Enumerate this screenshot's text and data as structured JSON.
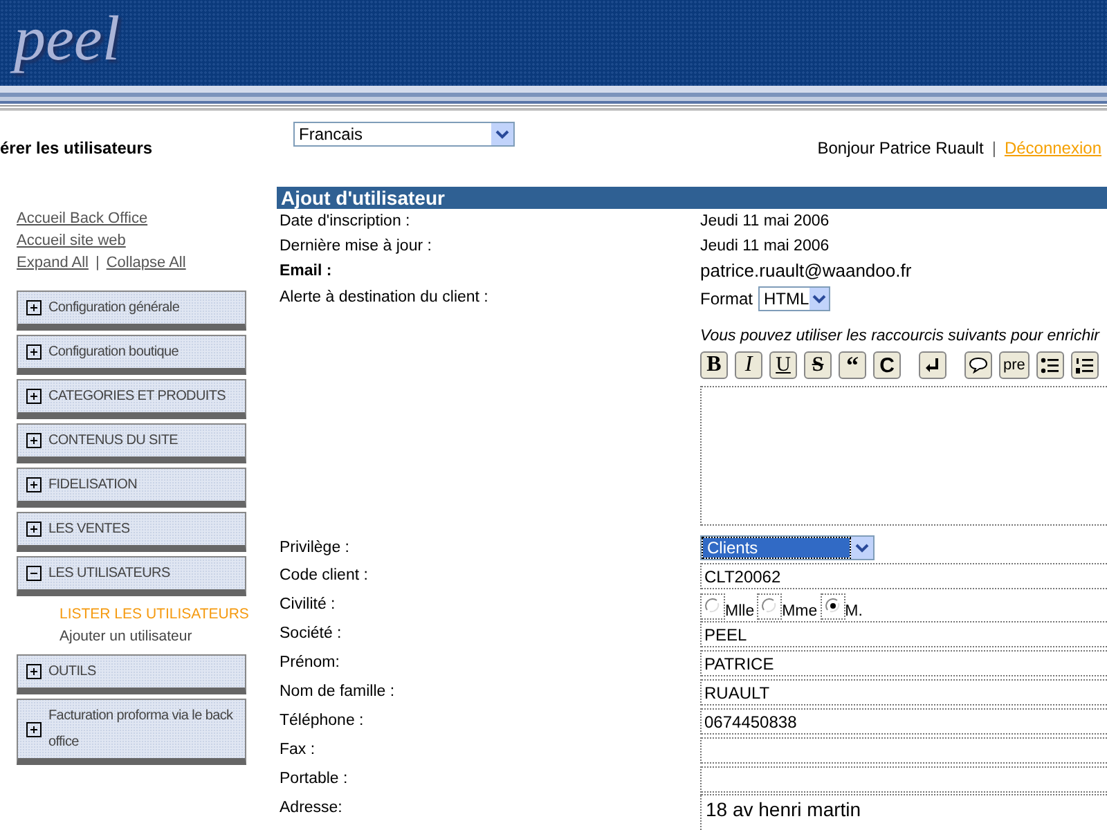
{
  "header": {
    "logo": "peel"
  },
  "top_bar": {
    "page_title": "érer les utilisateurs",
    "language": "Francais",
    "greeting": "Bonjour Patrice Ruault",
    "separator": "|",
    "logout": "Déconnexion"
  },
  "sidebar": {
    "links": [
      {
        "label": "Accueil Back Office"
      },
      {
        "label": "Accueil site web"
      }
    ],
    "expand_all": "Expand All",
    "link_separator": "|",
    "collapse_all": "Collapse All",
    "items": [
      {
        "label": "Configuration générale",
        "expanded": false
      },
      {
        "label": "Configuration boutique",
        "expanded": false
      },
      {
        "label": "CATEGORIES ET PRODUITS",
        "expanded": false
      },
      {
        "label": "CONTENUS DU SITE",
        "expanded": false
      },
      {
        "label": "FIDELISATION",
        "expanded": false
      },
      {
        "label": "LES VENTES",
        "expanded": false
      },
      {
        "label": "LES UTILISATEURS",
        "expanded": true,
        "children": [
          {
            "label": "LISTER LES UTILISATEURS",
            "selected": true
          },
          {
            "label": "Ajouter un utilisateur",
            "selected": false
          }
        ]
      },
      {
        "label": "OUTILS",
        "expanded": false
      },
      {
        "label": "Facturation proforma via le back office",
        "expanded": false
      }
    ]
  },
  "form": {
    "title": "Ajout d'utilisateur",
    "fields": [
      {
        "kind": "static",
        "label": "Date d'inscription :",
        "value": "Jeudi 11 mai 2006",
        "bold": false
      },
      {
        "kind": "static",
        "label": "Dernière mise à jour :",
        "value": "Jeudi 11 mai 2006",
        "bold": false
      },
      {
        "kind": "static",
        "label": "Email :",
        "value": "patrice.ruault@waandoo.fr",
        "bold": true
      },
      {
        "kind": "editor",
        "label": "Alerte à destination du client :",
        "format_label": "Format",
        "format_value": "HTML",
        "hint": "Vous pouvez utiliser les raccourcis suivants pour enrichir",
        "tools": [
          {
            "kind": "text",
            "text": "B"
          },
          {
            "kind": "text",
            "text": "I"
          },
          {
            "kind": "text",
            "text": "U"
          },
          {
            "kind": "text",
            "text": "S"
          },
          {
            "kind": "text",
            "text": "“"
          },
          {
            "kind": "text",
            "text": "C"
          },
          {
            "kind": "return"
          },
          {
            "kind": "bubble"
          },
          {
            "kind": "text",
            "text": "pre"
          },
          {
            "kind": "bullets"
          },
          {
            "kind": "numbers"
          }
        ]
      },
      {
        "kind": "select",
        "label": "Privilège :",
        "value": "Clients"
      },
      {
        "kind": "input",
        "label": "Code client :",
        "value": "CLT20062"
      },
      {
        "kind": "radio",
        "label": "Civilité :",
        "options": [
          {
            "label": "Mlle",
            "selected": false
          },
          {
            "label": "Mme",
            "selected": false
          },
          {
            "label": "M.",
            "selected": true
          }
        ]
      },
      {
        "kind": "input",
        "label": "Société :",
        "value": "PEEL"
      },
      {
        "kind": "input",
        "label": "Prénom:",
        "value": "PATRICE"
      },
      {
        "kind": "input",
        "label": "Nom de famille :",
        "value": "RUAULT"
      },
      {
        "kind": "input",
        "label": "Téléphone :",
        "value": "0674450838"
      },
      {
        "kind": "input",
        "label": "Fax :"
      },
      {
        "kind": "input",
        "label": "Portable :"
      },
      {
        "kind": "textarea",
        "label": "Adresse:",
        "value": "18 av henri martin"
      }
    ]
  }
}
